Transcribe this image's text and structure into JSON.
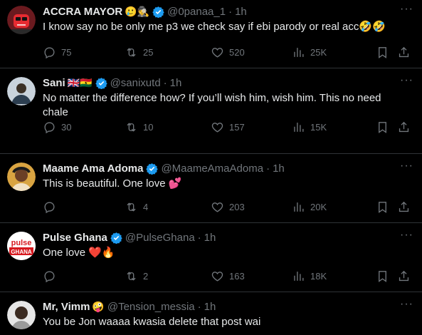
{
  "colors": {
    "background": "#000000",
    "text": "#e7e9ea",
    "muted": "#71767b",
    "verified": "#1d9bf0",
    "divider": "#2f3336"
  },
  "tweets": [
    {
      "name": "ACCRA MAYOR",
      "name_emoji": "🥲🕵",
      "handle": "@0panaa_1",
      "time": "1h",
      "text": "I know say no be only me p3 we check say if ebi parody or real acc🤣🤣",
      "replies": "75",
      "reposts": "25",
      "likes": "520",
      "views": "25K"
    },
    {
      "name": "Sani",
      "name_emoji": "🇬🇧🇬🇭",
      "handle": "@sanixutd",
      "time": "1h",
      "text": "No matter the difference how? If you’ll wish him, wish him. This no need chale",
      "replies": "30",
      "reposts": "10",
      "likes": "157",
      "views": "15K"
    },
    {
      "name": "Maame Ama Adoma",
      "handle": "@MaameAmaAdoma",
      "time": "1h",
      "text": "This is beautiful. One love 💕",
      "replies": "",
      "reposts": "4",
      "likes": "203",
      "views": "20K"
    },
    {
      "name": "Pulse Ghana",
      "handle": "@PulseGhana",
      "time": "1h",
      "text": "One love ❤️🔥",
      "replies": "",
      "reposts": "2",
      "likes": "163",
      "views": "18K",
      "avatar_text_top": "pulse",
      "avatar_text_bottom": "GHANA"
    },
    {
      "name": "Mr, Vimm",
      "name_emoji": "🤪",
      "handle": "@Tension_messia",
      "time": "1h",
      "text": "You be Jon waaaa kwasia delete that post wai"
    }
  ],
  "icons": {
    "more": "more-horizontal-icon",
    "reply": "reply-icon",
    "repost": "repost-icon",
    "like": "heart-icon",
    "views": "views-chart-icon",
    "bookmark": "bookmark-icon",
    "share": "share-icon",
    "verified": "verified-badge-icon"
  },
  "ui": {
    "dot": "·",
    "more_glyph": "···"
  }
}
